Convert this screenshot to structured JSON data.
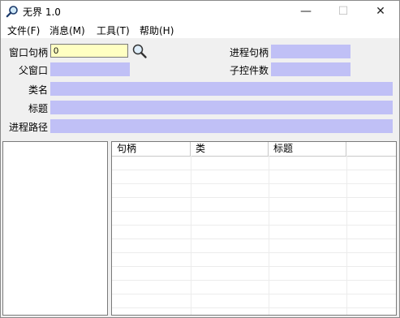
{
  "window": {
    "title": "无界 1.0",
    "minimize_glyph": "—",
    "maximize_glyph": "☐",
    "close_glyph": "✕",
    "app_icon": "magnifier-icon"
  },
  "menu": [
    {
      "label": "文件(F)"
    },
    {
      "label": "消息(M)"
    },
    {
      "label": "工具(T)"
    },
    {
      "label": "帮助(H)"
    }
  ],
  "fields": {
    "window_handle": {
      "label": "窗口句柄",
      "value": "0"
    },
    "process_handle": {
      "label": "进程句柄",
      "value": ""
    },
    "parent_window": {
      "label": "父窗口",
      "value": ""
    },
    "child_count": {
      "label": "子控件数",
      "value": ""
    },
    "class_name": {
      "label": "类名",
      "value": ""
    },
    "title": {
      "label": "标题",
      "value": ""
    },
    "process_path": {
      "label": "进程路径",
      "value": ""
    }
  },
  "find_button_icon": "magnifier-icon",
  "list": {
    "columns": [
      "句柄",
      "类",
      "标题"
    ],
    "rows": []
  },
  "colors": {
    "field_bg": "#c0c0f6",
    "input_bg": "#ffffc2"
  }
}
